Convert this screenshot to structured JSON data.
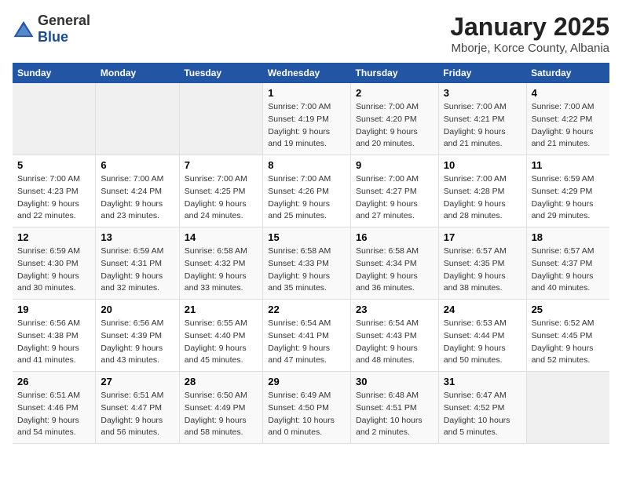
{
  "header": {
    "logo_general": "General",
    "logo_blue": "Blue",
    "main_title": "January 2025",
    "subtitle": "Mborje, Korce County, Albania"
  },
  "days_of_week": [
    "Sunday",
    "Monday",
    "Tuesday",
    "Wednesday",
    "Thursday",
    "Friday",
    "Saturday"
  ],
  "weeks": [
    [
      {
        "day": "",
        "info": ""
      },
      {
        "day": "",
        "info": ""
      },
      {
        "day": "",
        "info": ""
      },
      {
        "day": "1",
        "info": "Sunrise: 7:00 AM\nSunset: 4:19 PM\nDaylight: 9 hours\nand 19 minutes."
      },
      {
        "day": "2",
        "info": "Sunrise: 7:00 AM\nSunset: 4:20 PM\nDaylight: 9 hours\nand 20 minutes."
      },
      {
        "day": "3",
        "info": "Sunrise: 7:00 AM\nSunset: 4:21 PM\nDaylight: 9 hours\nand 21 minutes."
      },
      {
        "day": "4",
        "info": "Sunrise: 7:00 AM\nSunset: 4:22 PM\nDaylight: 9 hours\nand 21 minutes."
      }
    ],
    [
      {
        "day": "5",
        "info": "Sunrise: 7:00 AM\nSunset: 4:23 PM\nDaylight: 9 hours\nand 22 minutes."
      },
      {
        "day": "6",
        "info": "Sunrise: 7:00 AM\nSunset: 4:24 PM\nDaylight: 9 hours\nand 23 minutes."
      },
      {
        "day": "7",
        "info": "Sunrise: 7:00 AM\nSunset: 4:25 PM\nDaylight: 9 hours\nand 24 minutes."
      },
      {
        "day": "8",
        "info": "Sunrise: 7:00 AM\nSunset: 4:26 PM\nDaylight: 9 hours\nand 25 minutes."
      },
      {
        "day": "9",
        "info": "Sunrise: 7:00 AM\nSunset: 4:27 PM\nDaylight: 9 hours\nand 27 minutes."
      },
      {
        "day": "10",
        "info": "Sunrise: 7:00 AM\nSunset: 4:28 PM\nDaylight: 9 hours\nand 28 minutes."
      },
      {
        "day": "11",
        "info": "Sunrise: 6:59 AM\nSunset: 4:29 PM\nDaylight: 9 hours\nand 29 minutes."
      }
    ],
    [
      {
        "day": "12",
        "info": "Sunrise: 6:59 AM\nSunset: 4:30 PM\nDaylight: 9 hours\nand 30 minutes."
      },
      {
        "day": "13",
        "info": "Sunrise: 6:59 AM\nSunset: 4:31 PM\nDaylight: 9 hours\nand 32 minutes."
      },
      {
        "day": "14",
        "info": "Sunrise: 6:58 AM\nSunset: 4:32 PM\nDaylight: 9 hours\nand 33 minutes."
      },
      {
        "day": "15",
        "info": "Sunrise: 6:58 AM\nSunset: 4:33 PM\nDaylight: 9 hours\nand 35 minutes."
      },
      {
        "day": "16",
        "info": "Sunrise: 6:58 AM\nSunset: 4:34 PM\nDaylight: 9 hours\nand 36 minutes."
      },
      {
        "day": "17",
        "info": "Sunrise: 6:57 AM\nSunset: 4:35 PM\nDaylight: 9 hours\nand 38 minutes."
      },
      {
        "day": "18",
        "info": "Sunrise: 6:57 AM\nSunset: 4:37 PM\nDaylight: 9 hours\nand 40 minutes."
      }
    ],
    [
      {
        "day": "19",
        "info": "Sunrise: 6:56 AM\nSunset: 4:38 PM\nDaylight: 9 hours\nand 41 minutes."
      },
      {
        "day": "20",
        "info": "Sunrise: 6:56 AM\nSunset: 4:39 PM\nDaylight: 9 hours\nand 43 minutes."
      },
      {
        "day": "21",
        "info": "Sunrise: 6:55 AM\nSunset: 4:40 PM\nDaylight: 9 hours\nand 45 minutes."
      },
      {
        "day": "22",
        "info": "Sunrise: 6:54 AM\nSunset: 4:41 PM\nDaylight: 9 hours\nand 47 minutes."
      },
      {
        "day": "23",
        "info": "Sunrise: 6:54 AM\nSunset: 4:43 PM\nDaylight: 9 hours\nand 48 minutes."
      },
      {
        "day": "24",
        "info": "Sunrise: 6:53 AM\nSunset: 4:44 PM\nDaylight: 9 hours\nand 50 minutes."
      },
      {
        "day": "25",
        "info": "Sunrise: 6:52 AM\nSunset: 4:45 PM\nDaylight: 9 hours\nand 52 minutes."
      }
    ],
    [
      {
        "day": "26",
        "info": "Sunrise: 6:51 AM\nSunset: 4:46 PM\nDaylight: 9 hours\nand 54 minutes."
      },
      {
        "day": "27",
        "info": "Sunrise: 6:51 AM\nSunset: 4:47 PM\nDaylight: 9 hours\nand 56 minutes."
      },
      {
        "day": "28",
        "info": "Sunrise: 6:50 AM\nSunset: 4:49 PM\nDaylight: 9 hours\nand 58 minutes."
      },
      {
        "day": "29",
        "info": "Sunrise: 6:49 AM\nSunset: 4:50 PM\nDaylight: 10 hours\nand 0 minutes."
      },
      {
        "day": "30",
        "info": "Sunrise: 6:48 AM\nSunset: 4:51 PM\nDaylight: 10 hours\nand 2 minutes."
      },
      {
        "day": "31",
        "info": "Sunrise: 6:47 AM\nSunset: 4:52 PM\nDaylight: 10 hours\nand 5 minutes."
      },
      {
        "day": "",
        "info": ""
      }
    ]
  ]
}
